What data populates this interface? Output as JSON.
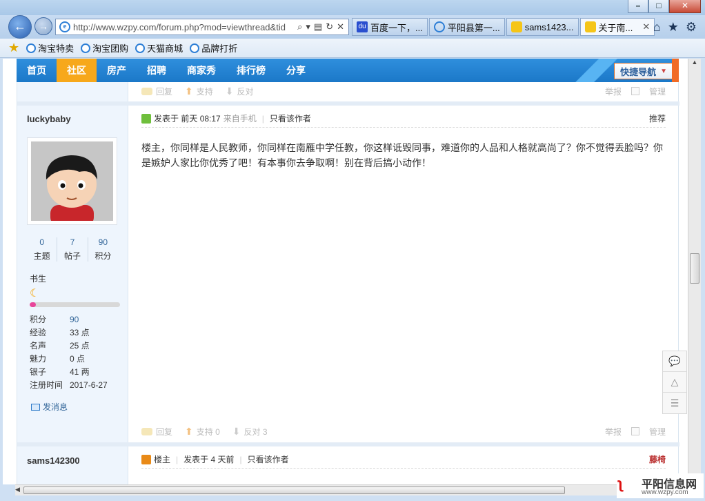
{
  "browser": {
    "address": "http://www.wzpy.com/forum.php?mod=viewthread&tid",
    "tabs": [
      {
        "label": "百度一下，...",
        "icon": "baidu-icon"
      },
      {
        "label": "平阳县第一...",
        "icon": "ie-icon"
      },
      {
        "label": "sams1423...",
        "icon": "qq-icon"
      },
      {
        "label": "关于南...",
        "icon": "qq-icon",
        "active": true
      }
    ],
    "favorites": [
      "淘宝特卖",
      "淘宝团购",
      "天猫商城",
      "品牌打折"
    ]
  },
  "sitenav": {
    "items": [
      "首页",
      "社区",
      "房产",
      "招聘",
      "商家秀",
      "排行榜",
      "分享"
    ],
    "active_index": 1,
    "quick_nav": "快捷导航"
  },
  "actions": {
    "reply": "回复",
    "support": "支持",
    "oppose": "反对",
    "report": "举报",
    "manage": "管理",
    "support_count": "支持 0",
    "oppose_count": "反对 3"
  },
  "post1": {
    "author": "luckybaby",
    "stats": [
      {
        "num": "0",
        "label": "主题"
      },
      {
        "num": "7",
        "label": "帖子"
      },
      {
        "num": "90",
        "label": "积分"
      }
    ],
    "rank": "书生",
    "progress": 0.07,
    "profile": [
      {
        "k": "积分",
        "v": "90",
        "link": true
      },
      {
        "k": "经验",
        "v": "33 点"
      },
      {
        "k": "名声",
        "v": "25 点"
      },
      {
        "k": "魅力",
        "v": "0 点"
      },
      {
        "k": "银子",
        "v": "41 两"
      },
      {
        "k": "注册时间",
        "v": "2017-6-27"
      }
    ],
    "send_msg": "发消息",
    "posted_label": "发表于",
    "posted_time": "前天 08:17",
    "from_mobile": "来自手机",
    "only_author": "只看该作者",
    "recommend": "推荐",
    "content": "楼主，你同样是人民教师，你同样在南雁中学任教，你这样诋毁同事，难道你的人品和人格就高尚了？你不觉得丢脸吗？你是嫉妒人家比你优秀了吧！有本事你去争取啊！别在背后搞小动作！"
  },
  "post2": {
    "author": "sams142300",
    "op_label": "楼主",
    "posted": "发表于 4 天前",
    "only_author": "只看该作者",
    "floor": "藤椅"
  },
  "site_logo": {
    "name": "平阳信息网",
    "url": "www.wzpy.com"
  }
}
